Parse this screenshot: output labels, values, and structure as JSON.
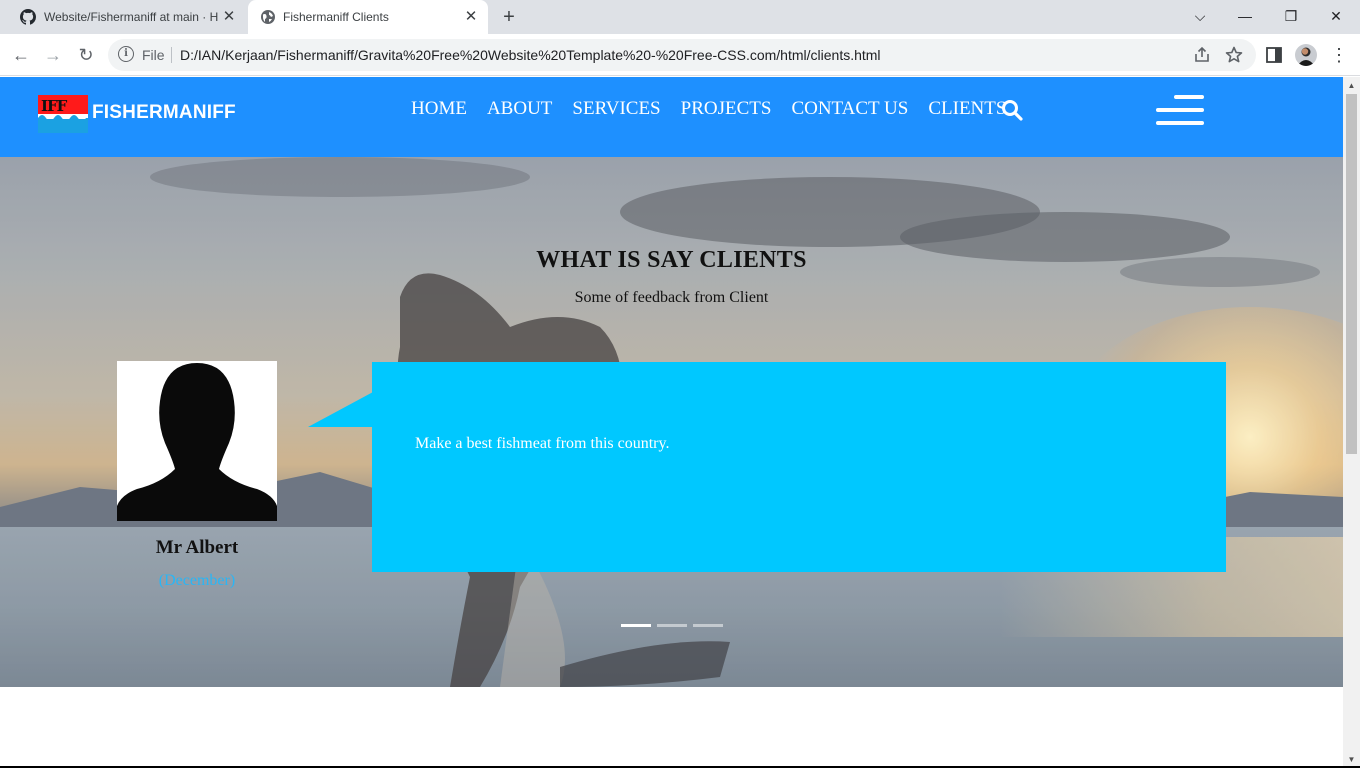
{
  "browser": {
    "tabs": [
      {
        "title": "Website/Fishermaniff at main · H",
        "favicon": "github-icon",
        "active": false
      },
      {
        "title": "Fishermaniff Clients",
        "favicon": "globe-icon",
        "active": true
      }
    ],
    "new_tab_symbol": "+",
    "window_controls": {
      "dropdown": "⌵",
      "minimize": "—",
      "restore": "❐",
      "close": "✕"
    },
    "tab_close_symbol": "✕",
    "nav": {
      "back": "←",
      "forward": "→",
      "reload": "↻"
    },
    "address": {
      "scheme_label": "File",
      "info_symbol": "i",
      "url": "D:/IAN/Kerjaan/Fishermaniff/Gravita%20Free%20Website%20Template%20-%20Free-CSS.com/html/clients.html"
    },
    "toolbar_icons": [
      "share-icon",
      "star-icon",
      "side-panel-icon",
      "profile-avatar",
      "kebab-menu-icon"
    ]
  },
  "site": {
    "logo_letters": "IFF",
    "brand": "FISHERMANIFF",
    "menu": [
      "HOME",
      "ABOUT",
      "SERVICES",
      "PROJECTS",
      "CONTACT US",
      "CLIENTS"
    ],
    "accent_color": "#1e90ff"
  },
  "clients_section": {
    "title": "WHAT IS SAY CLIENTS",
    "subtitle": "Some of feedback from Client",
    "testimonial": {
      "name": "Mr Albert",
      "role": "(December)",
      "quote": "Make a best fishmeat from this country."
    },
    "carousel": {
      "slides": 3,
      "active": 1
    },
    "bubble_color": "#00c8ff"
  }
}
